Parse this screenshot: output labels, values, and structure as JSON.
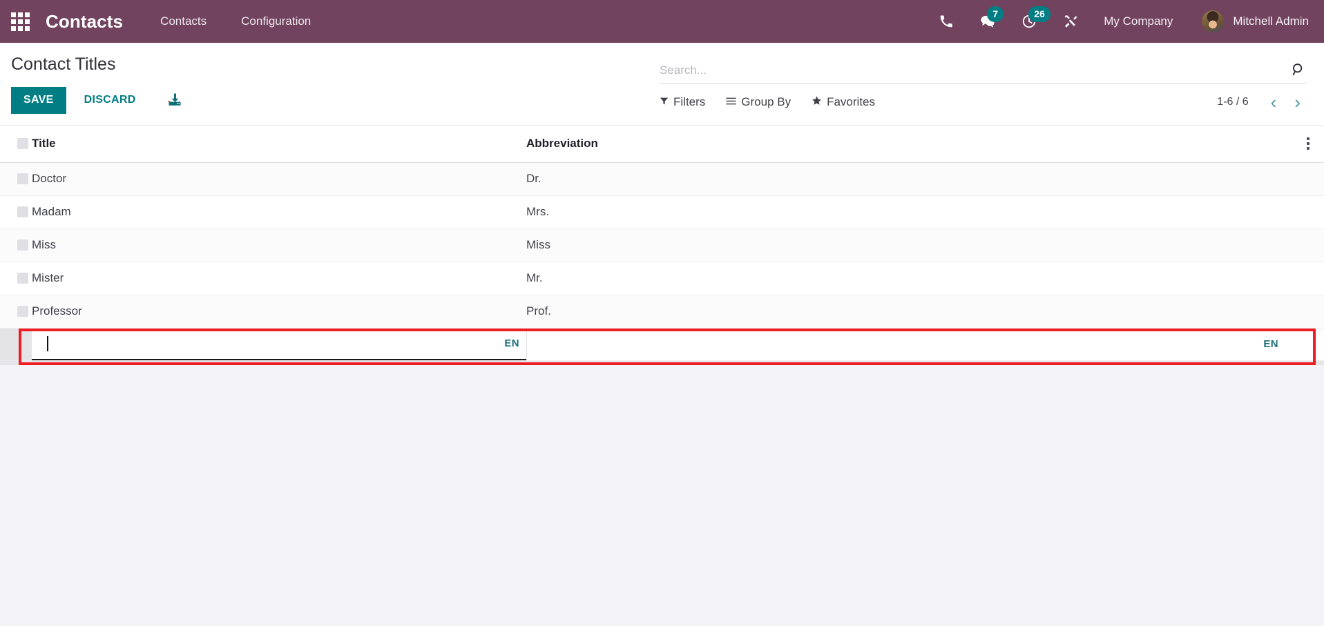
{
  "navbar": {
    "apps_icon": "apps-grid-icon",
    "brand": "Contacts",
    "menu_items": [
      {
        "label": "Contacts"
      },
      {
        "label": "Configuration"
      }
    ],
    "sys_icons": [
      {
        "name": "phone-icon",
        "badge": null
      },
      {
        "name": "messages-icon",
        "badge": "7"
      },
      {
        "name": "activities-clock-icon",
        "badge": "26"
      },
      {
        "name": "debug-tools-icon",
        "badge": null
      }
    ],
    "company": "My Company",
    "user": "Mitchell Admin",
    "bg_color": "#71435f",
    "badge_color": "#017e84"
  },
  "control_panel": {
    "title": "Contact Titles",
    "save_label": "SAVE",
    "discard_label": "DISCARD",
    "import_icon": "download-import-icon",
    "accent_color": "#017e84"
  },
  "search": {
    "placeholder": "Search...",
    "value": "",
    "search_icon": "search-icon"
  },
  "filters_bar": {
    "filters_label": "Filters",
    "filters_icon": "funnel-icon",
    "group_by_label": "Group By",
    "group_by_icon": "hamburger-lines-icon",
    "favorites_label": "Favorites",
    "favorites_icon": "star-icon"
  },
  "pager": {
    "range": "1-6 / 6",
    "prev_icon": "chevron-left-icon",
    "next_icon": "chevron-right-icon",
    "arrow_color": "#4e9a9e"
  },
  "list": {
    "columns": [
      "Title",
      "Abbreviation"
    ],
    "options_icon": "kebab-menu-icon",
    "rows": [
      {
        "title": "Doctor",
        "abbreviation": "Dr."
      },
      {
        "title": "Madam",
        "abbreviation": "Mrs."
      },
      {
        "title": "Miss",
        "abbreviation": "Miss"
      },
      {
        "title": "Mister",
        "abbreviation": "Mr."
      },
      {
        "title": "Professor",
        "abbreviation": "Prof."
      }
    ],
    "edit_row": {
      "title_value": "",
      "abbreviation_value": "",
      "title_lang": "EN",
      "abbreviation_lang": "EN",
      "highlight_color": "#f01c24"
    }
  }
}
